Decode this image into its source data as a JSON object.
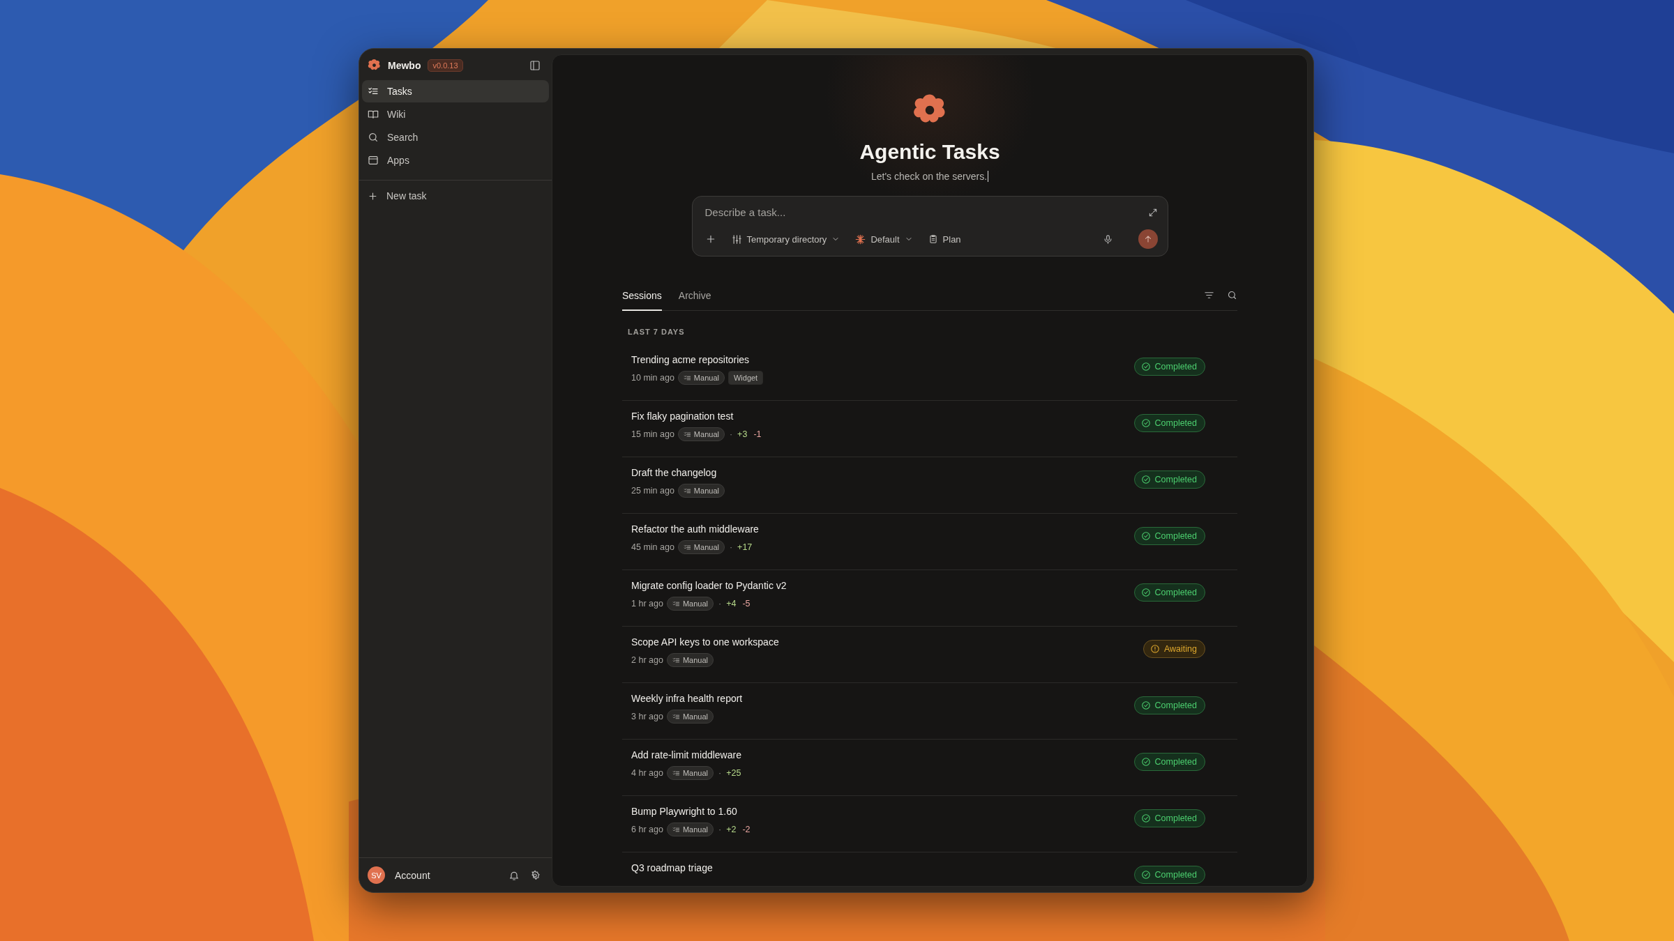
{
  "sidebar": {
    "app_name": "Mewbo",
    "version": "v0.0.13",
    "nav": [
      {
        "label": "Tasks",
        "selected": true
      },
      {
        "label": "Wiki",
        "selected": false
      },
      {
        "label": "Search",
        "selected": false
      },
      {
        "label": "Apps",
        "selected": false
      }
    ],
    "new_task": "New task",
    "account": {
      "initials": "SV",
      "label": "Account"
    }
  },
  "hero": {
    "title": "Agentic Tasks",
    "subtitle": "Let's check on the servers."
  },
  "composer": {
    "placeholder": "Describe a task...",
    "directory": "Temporary directory",
    "model": "Default",
    "mode": "Plan"
  },
  "tabs": [
    {
      "label": "Sessions",
      "selected": true
    },
    {
      "label": "Archive",
      "selected": false
    }
  ],
  "section": "LAST 7 DAYS",
  "sessions": [
    {
      "title": "Trending acme repositories",
      "time": "10 min ago",
      "tags": [
        {
          "kind": "source",
          "text": "Manual"
        },
        {
          "kind": "label",
          "text": "Widget"
        }
      ],
      "status": {
        "kind": "completed",
        "text": "Completed"
      }
    },
    {
      "title": "Fix flaky pagination test",
      "time": "15 min ago",
      "tags": [
        {
          "kind": "source",
          "text": "Manual"
        }
      ],
      "separator": "·",
      "added": "+3",
      "removed": "-1",
      "status": {
        "kind": "completed",
        "text": "Completed"
      }
    },
    {
      "title": "Draft the changelog",
      "time": "25 min ago",
      "tags": [
        {
          "kind": "source",
          "text": "Manual"
        }
      ],
      "status": {
        "kind": "completed",
        "text": "Completed"
      }
    },
    {
      "title": "Refactor the auth middleware",
      "time": "45 min ago",
      "tags": [
        {
          "kind": "source",
          "text": "Manual"
        }
      ],
      "separator": "·",
      "added": "+17",
      "status": {
        "kind": "completed",
        "text": "Completed"
      }
    },
    {
      "title": "Migrate config loader to Pydantic v2",
      "time": "1 hr ago",
      "tags": [
        {
          "kind": "source",
          "text": "Manual"
        }
      ],
      "separator": "·",
      "added": "+4",
      "removed": "-5",
      "status": {
        "kind": "completed",
        "text": "Completed"
      }
    },
    {
      "title": "Scope API keys to one workspace",
      "time": "2 hr ago",
      "tags": [
        {
          "kind": "source",
          "text": "Manual"
        }
      ],
      "status": {
        "kind": "awaiting",
        "text": "Awaiting"
      }
    },
    {
      "title": "Weekly infra health report",
      "time": "3 hr ago",
      "tags": [
        {
          "kind": "source",
          "text": "Manual"
        }
      ],
      "status": {
        "kind": "completed",
        "text": "Completed"
      }
    },
    {
      "title": "Add rate-limit middleware",
      "time": "4 hr ago",
      "tags": [
        {
          "kind": "source",
          "text": "Manual"
        }
      ],
      "separator": "·",
      "added": "+25",
      "status": {
        "kind": "completed",
        "text": "Completed"
      }
    },
    {
      "title": "Bump Playwright to 1.60",
      "time": "6 hr ago",
      "tags": [
        {
          "kind": "source",
          "text": "Manual"
        }
      ],
      "separator": "·",
      "added": "+2",
      "removed": "-2",
      "status": {
        "kind": "completed",
        "text": "Completed"
      }
    },
    {
      "title": "Q3 roadmap triage",
      "status": {
        "kind": "completed",
        "text": "Completed"
      }
    }
  ]
}
